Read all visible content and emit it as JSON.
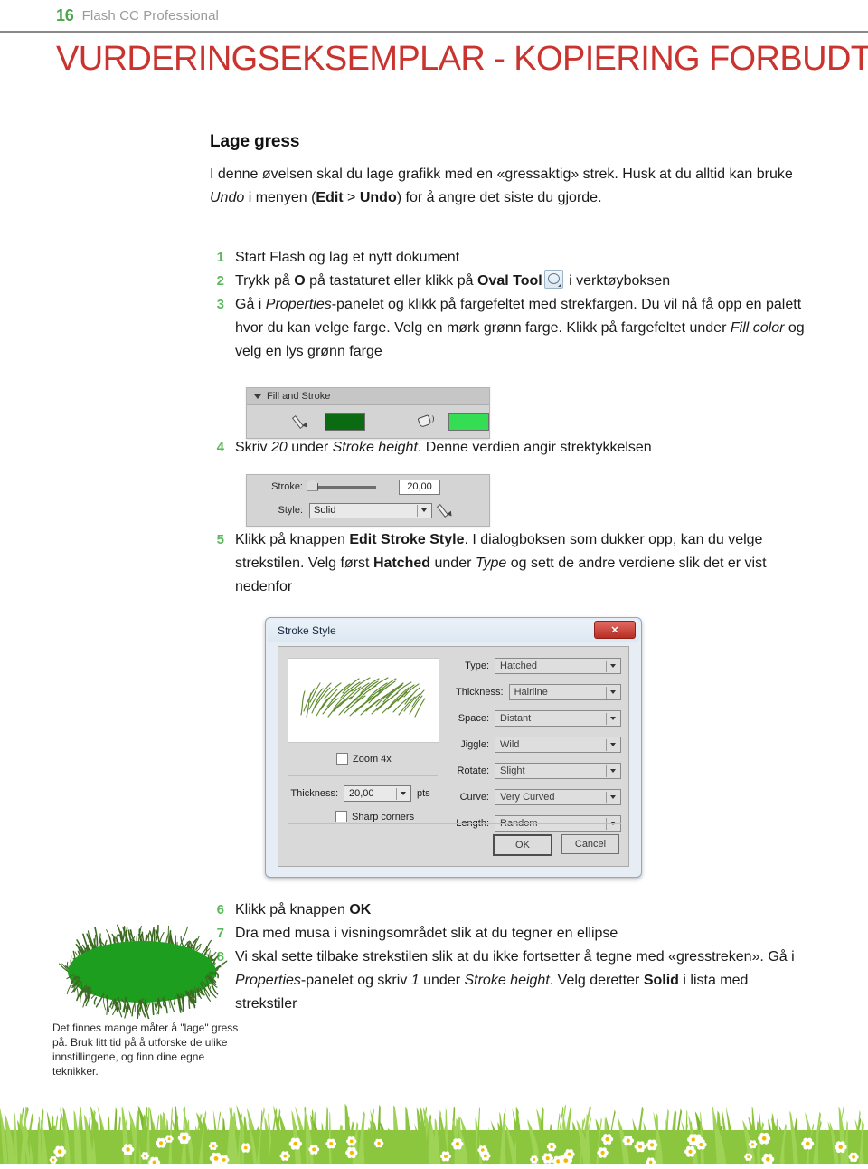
{
  "header": {
    "page_number": "16",
    "book_title": "Flash CC Professional",
    "accent_green": "#4ca64c",
    "title_gray": "#9b9b9b"
  },
  "watermark": {
    "text": "VURDERINGSEKSEMPLAR - KOPIERING FORBUDT!",
    "color": "#c9342f"
  },
  "section": {
    "title": "Lage gress",
    "intro_parts": {
      "p1": "I denne øvelsen skal du lage grafikk med en «gressaktig» strek. Husk at du alltid kan bruke ",
      "undo_italic": "Undo",
      "p2": " i menyen (",
      "edit_bold": "Edit",
      "p3": " > ",
      "undo_bold": "Undo",
      "p4": ") for å angre det siste du gjorde."
    }
  },
  "steps": {
    "s1": {
      "num": "1",
      "text": "Start Flash og lag et nytt dokument"
    },
    "s2": {
      "num": "2",
      "a": "Trykk på ",
      "o_bold": "O",
      "b": " på tastaturet eller klikk på ",
      "oval_tool_bold": "Oval Tool",
      "icon": "oval-tool-icon",
      "c": " i verktøyboksen"
    },
    "s3": {
      "num": "3",
      "a": "Gå i ",
      "properties_italic": "Properties",
      "b": "-panelet og klikk på fargefeltet med strekfargen. Du vil nå få opp en palett hvor du kan velge farge. Velg en mørk grønn farge. Klikk på fargefeltet under ",
      "fill_color_italic": "Fill color",
      "c": " og velg en lys grønn farge"
    },
    "s4": {
      "num": "4",
      "a": "Skriv ",
      "twenty_italic": "20",
      "b": " under ",
      "stroke_height_italic": "Stroke height",
      "c": ". Denne verdien angir strektykkelsen"
    },
    "s5": {
      "num": "5",
      "a": "Klikk på knappen ",
      "edit_stroke_style_bold": "Edit Stroke Style",
      "b": ". I dialogboksen som dukker opp, kan du velge strekstilen. Velg først ",
      "hatched_bold": "Hatched",
      "c": " under ",
      "type_italic": "Type",
      "d": " og sett de andre verdiene slik det er vist nedenfor"
    },
    "s6": {
      "num": "6",
      "a": "Klikk på knappen ",
      "ok_bold": "OK"
    },
    "s7": {
      "num": "7",
      "text": "Dra med musa i visningsområdet slik at du tegner en ellipse"
    },
    "s8": {
      "num": "8",
      "a": "Vi skal sette tilbake strekstilen slik at du ikke fortsetter å tegne med «gresstreken». Gå i ",
      "properties_italic": "Properties",
      "b": "-panelet og skriv ",
      "one_italic": "1",
      "c": " under ",
      "stroke_height_italic": "Stroke height",
      "d": ". Velg deretter ",
      "solid_bold": "Solid",
      "e": " i lista med strekstiler"
    }
  },
  "fill_stroke_panel": {
    "title": "Fill and Stroke",
    "stroke_swatch_color": "#0a6b12",
    "fill_swatch_color": "#35dd55",
    "stroke_icon": "pencil-icon",
    "fill_icon": "paint-bucket-icon"
  },
  "stroke_panel": {
    "stroke_label": "Stroke:",
    "stroke_value": "20,00",
    "style_label": "Style:",
    "style_value": "Solid",
    "edit_icon": "pencil-edit-icon"
  },
  "dialog": {
    "title": "Stroke Style",
    "close_label": "✕",
    "zoom_label": "Zoom 4x",
    "zoom_checked": false,
    "thickness_label": "Thickness:",
    "thickness_value": "20,00",
    "thickness_unit": "pts",
    "sharp_corners_label": "Sharp corners",
    "sharp_corners_checked": false,
    "fields": [
      {
        "label": "Type:",
        "value": "Hatched"
      },
      {
        "label": "Thickness:",
        "value": "Hairline"
      },
      {
        "label": "Space:",
        "value": "Distant"
      },
      {
        "label": "Jiggle:",
        "value": "Wild"
      },
      {
        "label": "Rotate:",
        "value": "Slight"
      },
      {
        "label": "Curve:",
        "value": "Very Curved"
      },
      {
        "label": "Length:",
        "value": "Random"
      }
    ],
    "ok_label": "OK",
    "cancel_label": "Cancel"
  },
  "caption": {
    "text": "Det finnes mange måter å \"lage\" gress på. Bruk litt tid på å utforske de ulike innstillingene, og finn dine egne teknikker."
  },
  "illustration": {
    "ellipse_fill": "#1e9e1e",
    "grass_stroke": "#3a6b21"
  },
  "footer_decoration": {
    "grass_light": "#9fd356",
    "grass_mid": "#8cc63f",
    "grass_dark": "#7cb82f",
    "flower_petal": "#ffffff",
    "flower_center": "#f5b800"
  }
}
